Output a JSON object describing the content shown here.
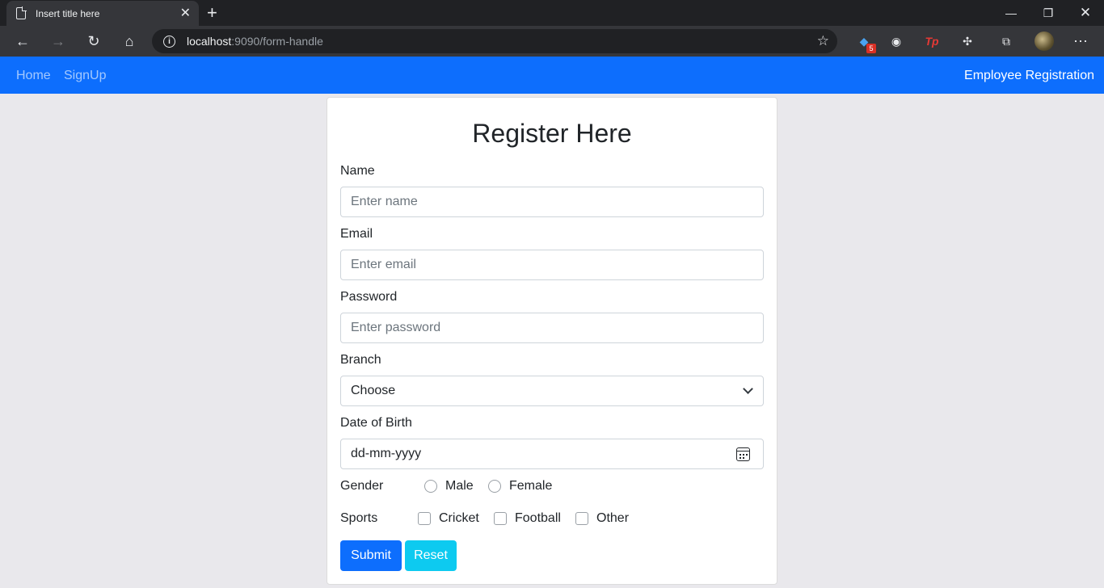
{
  "browser": {
    "tab_title": "Insert title here",
    "url_host": "localhost",
    "url_rest": ":9090/form-handle",
    "extension_badge": "5",
    "tp_label": "Tp"
  },
  "navbar": {
    "home": "Home",
    "signup": "SignUp",
    "brand": "Employee Registration"
  },
  "form": {
    "title": "Register Here",
    "name_label": "Name",
    "name_placeholder": "Enter name",
    "email_label": "Email",
    "email_placeholder": "Enter email",
    "password_label": "Password",
    "password_placeholder": "Enter password",
    "branch_label": "Branch",
    "branch_selected": "Choose",
    "dob_label": "Date of Birth",
    "dob_placeholder": "dd-mm-yyyy",
    "gender_label": "Gender",
    "gender_options": [
      "Male",
      "Female"
    ],
    "sports_label": "Sports",
    "sports_options": [
      "Cricket",
      "Football",
      "Other"
    ],
    "submit": "Submit",
    "reset": "Reset"
  },
  "colors": {
    "navbar": "#0d6efd",
    "primary": "#0d6efd",
    "info": "#0dcaf0",
    "page_bg": "#e9e8ec"
  }
}
